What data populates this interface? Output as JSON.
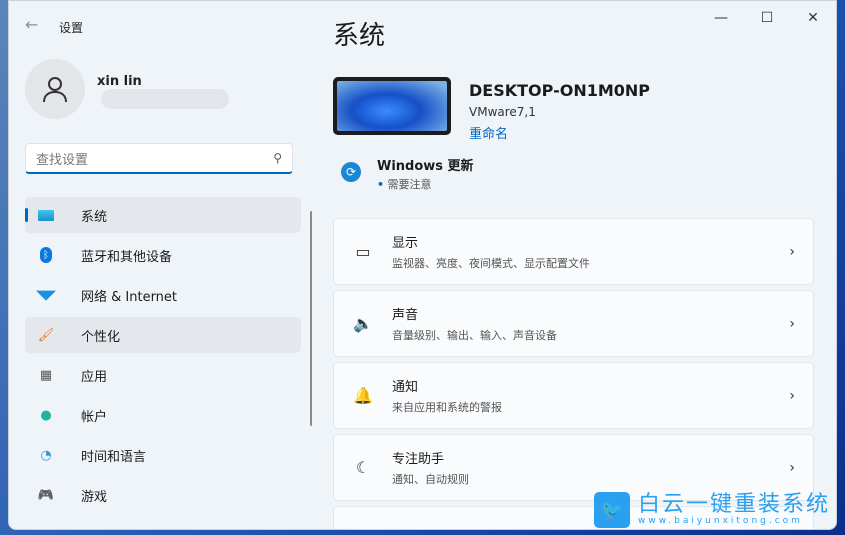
{
  "window": {
    "title": "设置",
    "back": "←",
    "minimize": "—",
    "maximize": "☐",
    "close": "✕"
  },
  "user": {
    "name": "xin lin"
  },
  "search": {
    "placeholder": "查找设置"
  },
  "nav": [
    {
      "label": "系统",
      "icon": "display-icon"
    },
    {
      "label": "蓝牙和其他设备",
      "icon": "bluetooth-icon"
    },
    {
      "label": "网络 & Internet",
      "icon": "wifi-icon"
    },
    {
      "label": "个性化",
      "icon": "brush-icon"
    },
    {
      "label": "应用",
      "icon": "apps-icon"
    },
    {
      "label": "帐户",
      "icon": "person-icon"
    },
    {
      "label": "时间和语言",
      "icon": "globe-clock-icon"
    },
    {
      "label": "游戏",
      "icon": "gamepad-icon"
    }
  ],
  "main": {
    "title": "系统",
    "device": {
      "name": "DESKTOP-ON1M0NP",
      "model": "VMware7,1",
      "rename": "重命名"
    },
    "update": {
      "title": "Windows 更新",
      "status": "需要注意"
    },
    "cards": [
      {
        "title": "显示",
        "subtitle": "监视器、亮度、夜间模式、显示配置文件",
        "icon": "monitor-icon"
      },
      {
        "title": "声音",
        "subtitle": "音量级别、输出、输入、声音设备",
        "icon": "speaker-icon"
      },
      {
        "title": "通知",
        "subtitle": "来自应用和系统的警报",
        "icon": "bell-icon"
      },
      {
        "title": "专注助手",
        "subtitle": "通知、自动规则",
        "icon": "moon-icon"
      }
    ]
  },
  "watermark": {
    "text": "白云一键重装系统",
    "url": "www.baiyunxitong.com"
  }
}
